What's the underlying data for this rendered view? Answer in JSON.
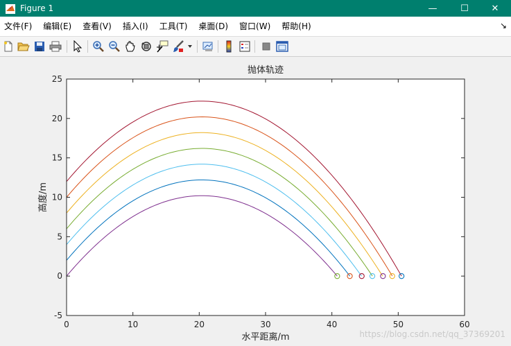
{
  "window": {
    "title": "Figure 1",
    "minimize_glyph": "—",
    "maximize_glyph": "☐",
    "close_glyph": "✕"
  },
  "menu": {
    "items": [
      "文件(F)",
      "编辑(E)",
      "查看(V)",
      "插入(I)",
      "工具(T)",
      "桌面(D)",
      "窗口(W)",
      "帮助(H)"
    ],
    "overflow_glyph": "↘"
  },
  "toolbar": {
    "icons": [
      "new-figure-icon",
      "open-file-icon",
      "save-icon",
      "print-icon",
      "pointer-icon",
      "zoom-in-icon",
      "zoom-out-icon",
      "pan-icon",
      "rotate-3d-icon",
      "data-cursor-icon",
      "brush-icon",
      "brush-dropdown-icon",
      "link-plot-icon",
      "colorbar-icon",
      "legend-icon",
      "hide-plot-tools-icon",
      "show-plot-tools-icon"
    ]
  },
  "watermark": "https://blog.csdn.net/qq_37369201",
  "chart_data": {
    "type": "line",
    "title": "抛体轨迹",
    "xlabel": "水平距离/m",
    "ylabel": "高度/m",
    "xlim": [
      0,
      60
    ],
    "ylim": [
      -5,
      25
    ],
    "xticks": [
      0,
      10,
      20,
      30,
      40,
      50,
      60
    ],
    "yticks": [
      -5,
      0,
      5,
      10,
      15,
      20,
      25
    ],
    "grid": false,
    "legend": "none",
    "colors": {
      "axes_bg": "#ffffff",
      "figure_bg": "#f0f0f0",
      "titlebar": "#007f6e"
    },
    "series": [
      {
        "color": "#7e2f8e",
        "start_height": 0,
        "peak": [
          20.4,
          10.2
        ],
        "landing_x": 40.8
      },
      {
        "color": "#0072bd",
        "start_height": 2,
        "peak": [
          20.4,
          12.2
        ],
        "landing_x": 42.7
      },
      {
        "color": "#4dbeee",
        "start_height": 4,
        "peak": [
          20.4,
          14.2
        ],
        "landing_x": 44.5
      },
      {
        "color": "#77ac30",
        "start_height": 6,
        "peak": [
          20.4,
          16.2
        ],
        "landing_x": 46.1
      },
      {
        "color": "#edb120",
        "start_height": 8,
        "peak": [
          20.4,
          18.2
        ],
        "landing_x": 47.7
      },
      {
        "color": "#d95319",
        "start_height": 10,
        "peak": [
          20.4,
          20.2
        ],
        "landing_x": 49.1
      },
      {
        "color": "#a2142f",
        "start_height": 12,
        "peak": [
          20.4,
          22.2
        ],
        "landing_x": 50.5
      }
    ],
    "landing_markers": [
      {
        "x": 40.8,
        "y": 0,
        "color": "#77ac30"
      },
      {
        "x": 42.7,
        "y": 0,
        "color": "#d95319"
      },
      {
        "x": 44.5,
        "y": 0,
        "color": "#a2142f"
      },
      {
        "x": 46.1,
        "y": 0,
        "color": "#4dbeee"
      },
      {
        "x": 47.7,
        "y": 0,
        "color": "#7e2f8e"
      },
      {
        "x": 49.1,
        "y": 0,
        "color": "#edb120"
      },
      {
        "x": 50.5,
        "y": 0,
        "color": "#0072bd"
      }
    ]
  }
}
